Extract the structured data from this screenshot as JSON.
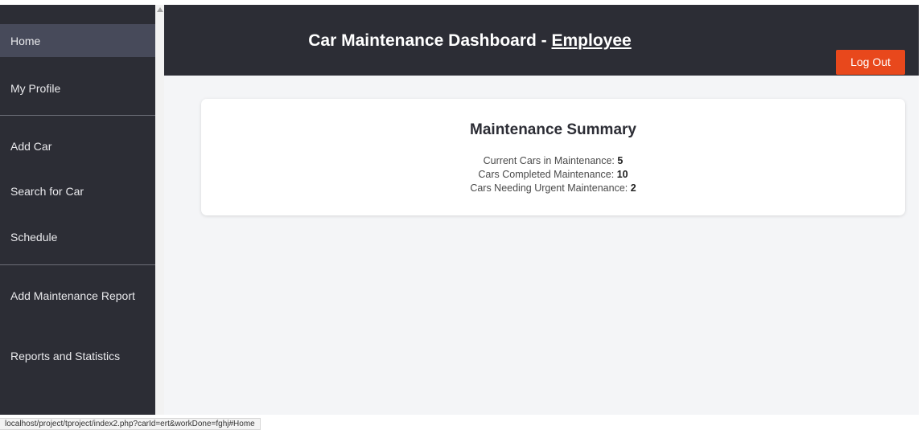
{
  "sidebar": {
    "items": [
      {
        "label": "Home"
      },
      {
        "label": "My Profile"
      },
      {
        "label": "Add Car"
      },
      {
        "label": "Search for Car"
      },
      {
        "label": "Schedule"
      },
      {
        "label": "Add Maintenance Report"
      },
      {
        "label": "Reports and Statistics"
      }
    ],
    "active_item": "Home"
  },
  "header": {
    "title_prefix": "Car Maintenance Dashboard - ",
    "role": "Employee",
    "logout_label": "Log Out"
  },
  "summary": {
    "title": "Maintenance Summary",
    "stats": [
      {
        "label": "Current Cars in Maintenance: ",
        "value": "5"
      },
      {
        "label": "Cars Completed Maintenance: ",
        "value": "10"
      },
      {
        "label": "Cars Needing Urgent Maintenance: ",
        "value": "2"
      }
    ]
  },
  "status_bar": {
    "url": "localhost/project/tproject/index2.php?carId=ert&workDone=fghj#Home"
  },
  "colors": {
    "sidebar_bg": "#2c2d35",
    "active_item_bg": "#474a5a",
    "logout_button": "#e8481c",
    "main_bg": "#f4f5f7"
  }
}
